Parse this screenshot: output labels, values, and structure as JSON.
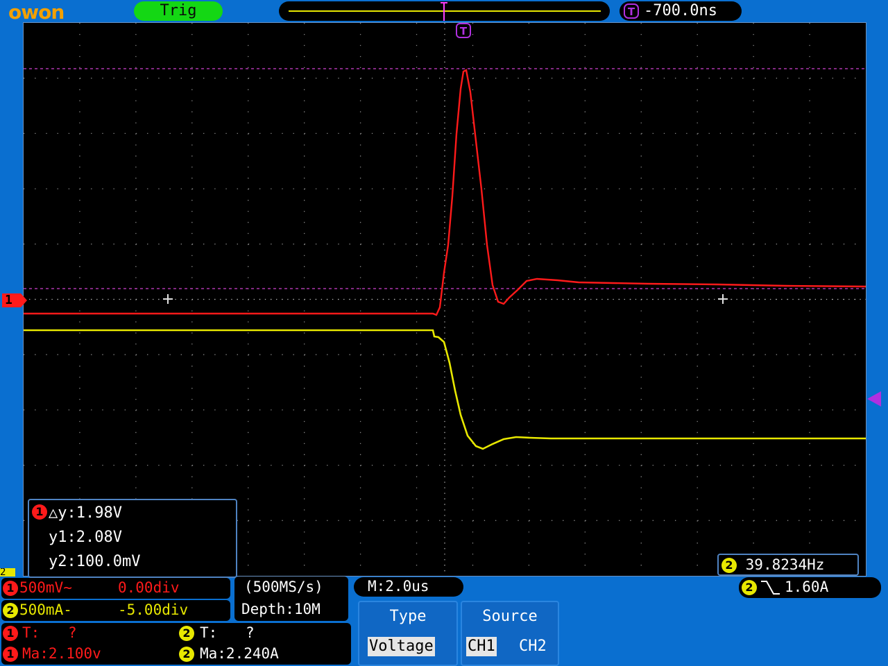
{
  "brand": "owon",
  "top_bar": {
    "trigger_status": "Trig",
    "horizontal_position": "-700.0ns"
  },
  "colors": {
    "ch1": "#ff1a1a",
    "ch2": "#e8e800",
    "trigger": "#b030e0",
    "background": "#0a6fd0"
  },
  "markers": {
    "ch1": "1",
    "ch2": "2",
    "trigger_icon": "T"
  },
  "cursors": {
    "channel": "1",
    "delta_y": "△y:1.98V",
    "y1": "y1:2.08V",
    "y2": "y2:100.0mV"
  },
  "frequency": {
    "channel": "2",
    "value": "39.8234Hz"
  },
  "channels": {
    "ch1": {
      "badge": "1",
      "scale": "500mV~",
      "offset": "0.00div"
    },
    "ch2": {
      "badge": "2",
      "scale": "500mA-",
      "offset": "-5.00div"
    }
  },
  "acquisition": {
    "sample_rate": "(500MS/s)",
    "depth": "Depth:10M"
  },
  "timebase": "M:2.0us",
  "trigger_info": {
    "channel": "2",
    "level": "1.60A",
    "slope_icon": "falling-edge-icon"
  },
  "measurements": {
    "ch1_period": {
      "badge": "1",
      "label": "T:",
      "value": "?"
    },
    "ch2_period": {
      "badge": "2",
      "label": "T:",
      "value": "?"
    },
    "ch1_max": {
      "badge": "1",
      "text": "Ma:2.100v"
    },
    "ch2_max": {
      "badge": "2",
      "text": "Ma:2.240A"
    }
  },
  "menu": {
    "type": {
      "title": "Type",
      "option": "Voltage"
    },
    "source": {
      "title": "Source",
      "options": [
        "CH1",
        "CH2"
      ],
      "selected": "CH1"
    }
  }
}
